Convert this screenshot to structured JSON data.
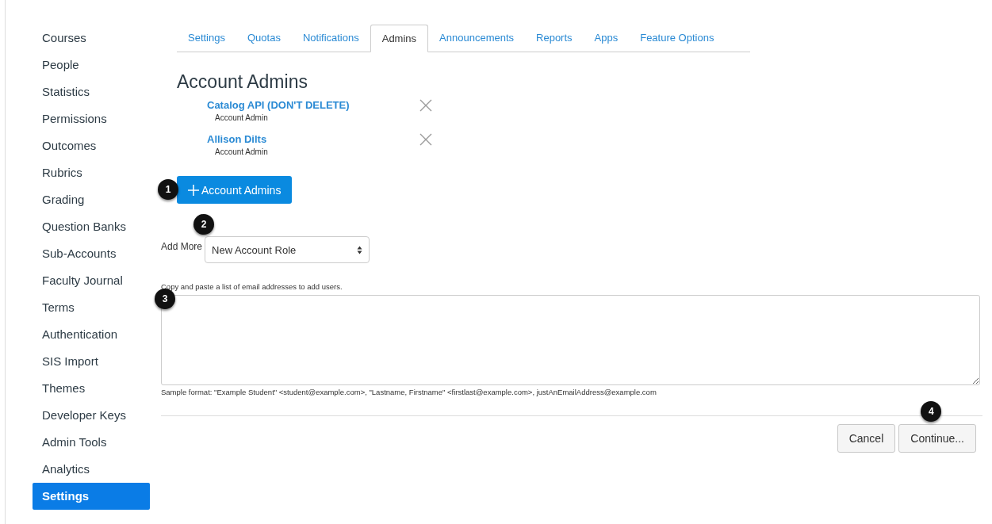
{
  "sidebar": {
    "items": [
      {
        "label": "Courses",
        "selected": false
      },
      {
        "label": "People",
        "selected": false
      },
      {
        "label": "Statistics",
        "selected": false
      },
      {
        "label": "Permissions",
        "selected": false
      },
      {
        "label": "Outcomes",
        "selected": false
      },
      {
        "label": "Rubrics",
        "selected": false
      },
      {
        "label": "Grading",
        "selected": false
      },
      {
        "label": "Question Banks",
        "selected": false
      },
      {
        "label": "Sub-Accounts",
        "selected": false
      },
      {
        "label": "Faculty Journal",
        "selected": false
      },
      {
        "label": "Terms",
        "selected": false
      },
      {
        "label": "Authentication",
        "selected": false
      },
      {
        "label": "SIS Import",
        "selected": false
      },
      {
        "label": "Themes",
        "selected": false
      },
      {
        "label": "Developer Keys",
        "selected": false
      },
      {
        "label": "Admin Tools",
        "selected": false
      },
      {
        "label": "Analytics",
        "selected": false
      },
      {
        "label": "Settings",
        "selected": true
      }
    ]
  },
  "tabs": [
    {
      "label": "Settings",
      "selected": false
    },
    {
      "label": "Quotas",
      "selected": false
    },
    {
      "label": "Notifications",
      "selected": false
    },
    {
      "label": "Admins",
      "selected": true
    },
    {
      "label": "Announcements",
      "selected": false
    },
    {
      "label": "Reports",
      "selected": false
    },
    {
      "label": "Apps",
      "selected": false
    },
    {
      "label": "Feature Options",
      "selected": false
    }
  ],
  "heading": "Account Admins",
  "admins": [
    {
      "name": "Catalog API (DON'T DELETE)",
      "role": "Account Admin"
    },
    {
      "name": "Allison Dilts",
      "role": "Account Admin"
    }
  ],
  "add_button": "Account Admins",
  "add_more": {
    "label": "Add More",
    "select_value": "New Account Role"
  },
  "email_hint": "Copy and paste a list of email addresses to add users.",
  "sample_format": "Sample format: \"Example Student\" <student@example.com>, \"Lastname, Firstname\" <firstlast@example.com>, justAnEmailAddress@example.com",
  "buttons": [
    "Cancel",
    "Continue..."
  ],
  "steps": [
    "1",
    "2",
    "3",
    "4"
  ]
}
